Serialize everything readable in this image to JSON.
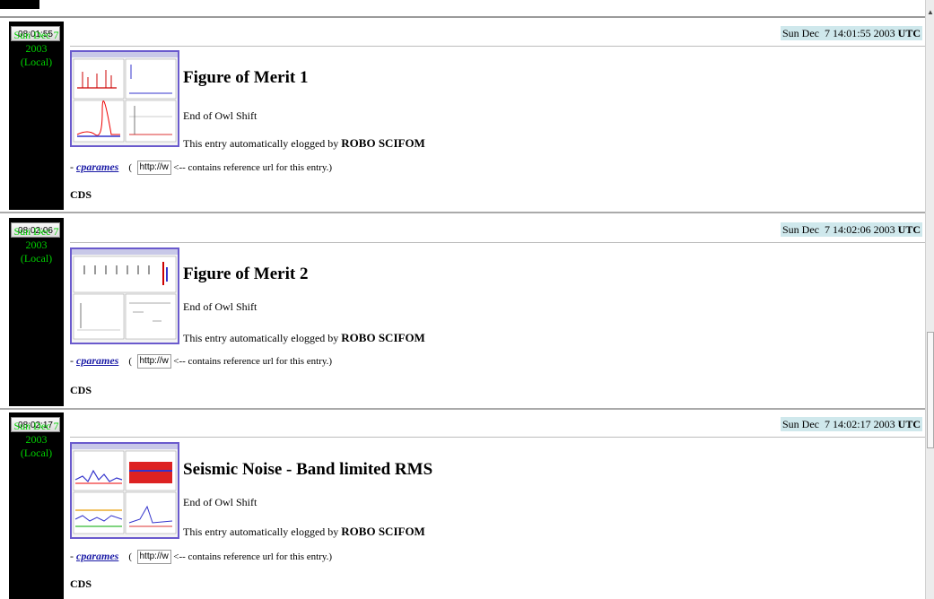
{
  "entries": [
    {
      "time_button": "08:01:55",
      "local_date": "Sun Dec 7",
      "local_year": "2003",
      "local_label": "(Local)",
      "utc_date": "Sun Dec  7 14:01:55 2003 ",
      "utc_suffix": "UTC",
      "title": "Figure of Merit 1",
      "subtitle": "End of Owl Shift",
      "auto_text": "This entry automatically elogged by ",
      "auto_author": "ROBO SCIFOM",
      "ref_link": "cparames",
      "ref_prefix": "(",
      "ref_url": "http://www",
      "ref_note": "<-- contains reference url for this entry.)",
      "group": "CDS"
    },
    {
      "time_button": "08:02:06",
      "local_date": "Sun Dec 7",
      "local_year": "2003",
      "local_label": "(Local)",
      "utc_date": "Sun Dec  7 14:02:06 2003 ",
      "utc_suffix": "UTC",
      "title": "Figure of Merit 2",
      "subtitle": "End of Owl Shift",
      "auto_text": "This entry automatically elogged by ",
      "auto_author": "ROBO SCIFOM",
      "ref_link": "cparames",
      "ref_prefix": "(",
      "ref_url": "http://www",
      "ref_note": "<-- contains reference url for this entry.)",
      "group": "CDS"
    },
    {
      "time_button": "08:02:17",
      "local_date": "Sun Dec 7",
      "local_year": "2003",
      "local_label": "(Local)",
      "utc_date": "Sun Dec  7 14:02:17 2003 ",
      "utc_suffix": "UTC",
      "title": "Seismic Noise - Band limited RMS",
      "subtitle": "End of Owl Shift",
      "auto_text": "This entry automatically elogged by ",
      "auto_author": "ROBO SCIFOM",
      "ref_link": "cparames",
      "ref_prefix": "(",
      "ref_url": "http://www",
      "ref_note": "<-- contains reference url for this entry.)",
      "group": "CDS"
    }
  ],
  "colors": {
    "local_date": "#00d000",
    "utc_bg": "#cfe8ec",
    "link": "#1a1aa6",
    "thumb_border": "#6a5acd"
  },
  "icons": {
    "scroll_up": "scroll-up-arrow-icon"
  }
}
